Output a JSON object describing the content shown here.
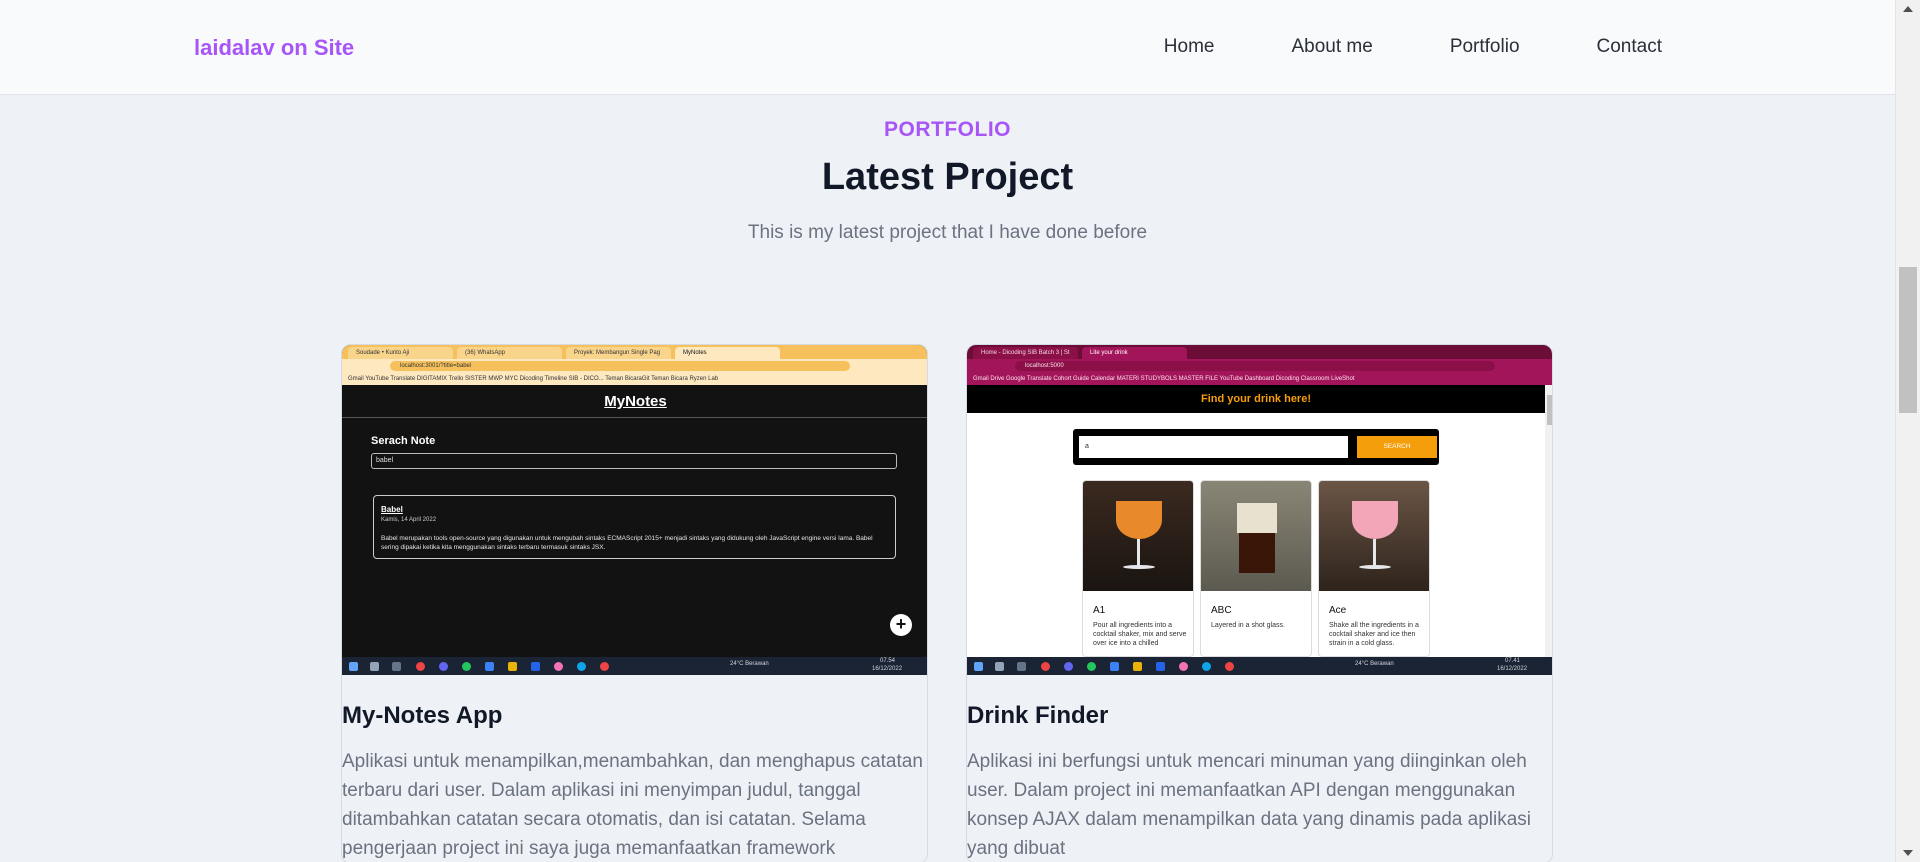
{
  "header": {
    "brand": "laidalav on Site",
    "nav": [
      "Home",
      "About me",
      "Portfolio",
      "Contact"
    ]
  },
  "section": {
    "kicker": "PORTFOLIO",
    "title": "Latest Project",
    "subtitle": "This is my latest project that I have done before"
  },
  "projects": [
    {
      "title": "My-Notes App",
      "description": "Aplikasi untuk menampilkan,menambahkan, dan menghapus catatan terbaru dari user. Dalam aplikasi ini menyimpan judul, tanggal ditambahkan catatan secara otomatis, dan isi catatan. Selama pengerjaan project ini saya juga memanfaatkan framework",
      "shot": {
        "tabs": [
          "Soudade • Kunto Aji",
          "(36) WhatsApp",
          "Proyek: Membangun Single Pag",
          "MyNotes"
        ],
        "url": "localhost:3001/?title=babel",
        "bookmarks": "Gmail   YouTube   Translate   DIGITAMIX   Trello   SISTER   MWP   MYC   Dicoding   Timeline SIB - DICO...   Teman BicaraGit   Teman Bicara   Ryzen Lab",
        "app_title": "MyNotes",
        "search_label": "Serach Note",
        "search_value": "babel",
        "note_title": "Babel",
        "note_date": "Kamis, 14 April 2022",
        "note_body": "Babel merupakan tools open-source yang digunakan untuk mengubah sintaks ECMAScript 2015+ menjadi sintaks yang didukung oleh JavaScript engine versi lama. Babel sering dipakai ketika kita menggunakan sintaks terbaru termasuk sintaks JSX.",
        "fab": "+",
        "weather": "24°C  Berawan",
        "clock": "07.54",
        "date": "16/12/2022"
      }
    },
    {
      "title": "Drink Finder",
      "description": "Aplikasi ini berfungsi untuk mencari minuman yang diinginkan oleh user. Dalam project ini memanfaatkan API dengan menggunakan konsep AJAX dalam menampilkan data yang dinamis pada aplikasi yang dibuat",
      "shot": {
        "tabs": [
          "Home - Dicoding SIB Batch 3 | St",
          "Lite your drink"
        ],
        "url": "localhost:5000",
        "bookmarks": "Gmail   Drive   Google Translate   Cohort Guide   Calendar   MATERI STUDYBOLS   MASTER FILE   YouTube   Dashboard Dicoding   Classroom   LiveShot",
        "banner": "Find your drink here!",
        "search_value": "a",
        "search_button": "SEARCH",
        "drinks": [
          {
            "name": "A1",
            "desc": "Pour all ingredients into a cocktail shaker, mix and serve over ice into a chilled"
          },
          {
            "name": "ABC",
            "desc": "Layered in a shot glass."
          },
          {
            "name": "Ace",
            "desc": "Shake all the ingredients in a cocktail shaker and ice then strain in a cold glass."
          }
        ],
        "weather": "24°C  Berawan",
        "clock": "07.41",
        "date": "16/12/2022"
      }
    }
  ],
  "colors": {
    "accent": "#a855f7",
    "background": "#eef2f7",
    "drink_accent": "#f59e0b",
    "drink_chrome": "#8b1048"
  }
}
